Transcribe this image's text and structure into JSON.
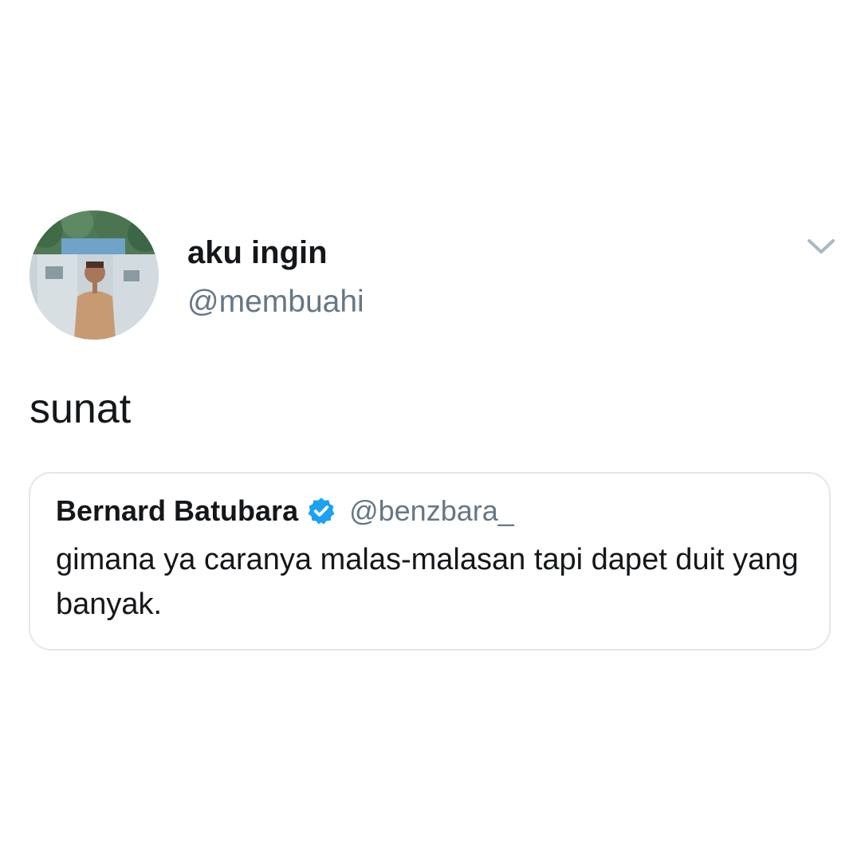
{
  "author": {
    "display_name": "aku ingin",
    "handle": "@membuahi"
  },
  "tweet": {
    "text": "sunat"
  },
  "quoted_tweet": {
    "display_name": "Bernard Batubara",
    "verified": true,
    "handle": "@benzbara_",
    "text": "gimana ya caranya malas-malasan tapi dapet duit yang banyak."
  },
  "icons": {
    "menu": "chevron-down-icon",
    "verified": "verified-badge-icon"
  },
  "colors": {
    "text_primary": "#14171a",
    "text_secondary": "#657786",
    "border": "#e1e8ed",
    "verified_blue": "#1da1f2",
    "caret_gray": "#aab8c2"
  }
}
